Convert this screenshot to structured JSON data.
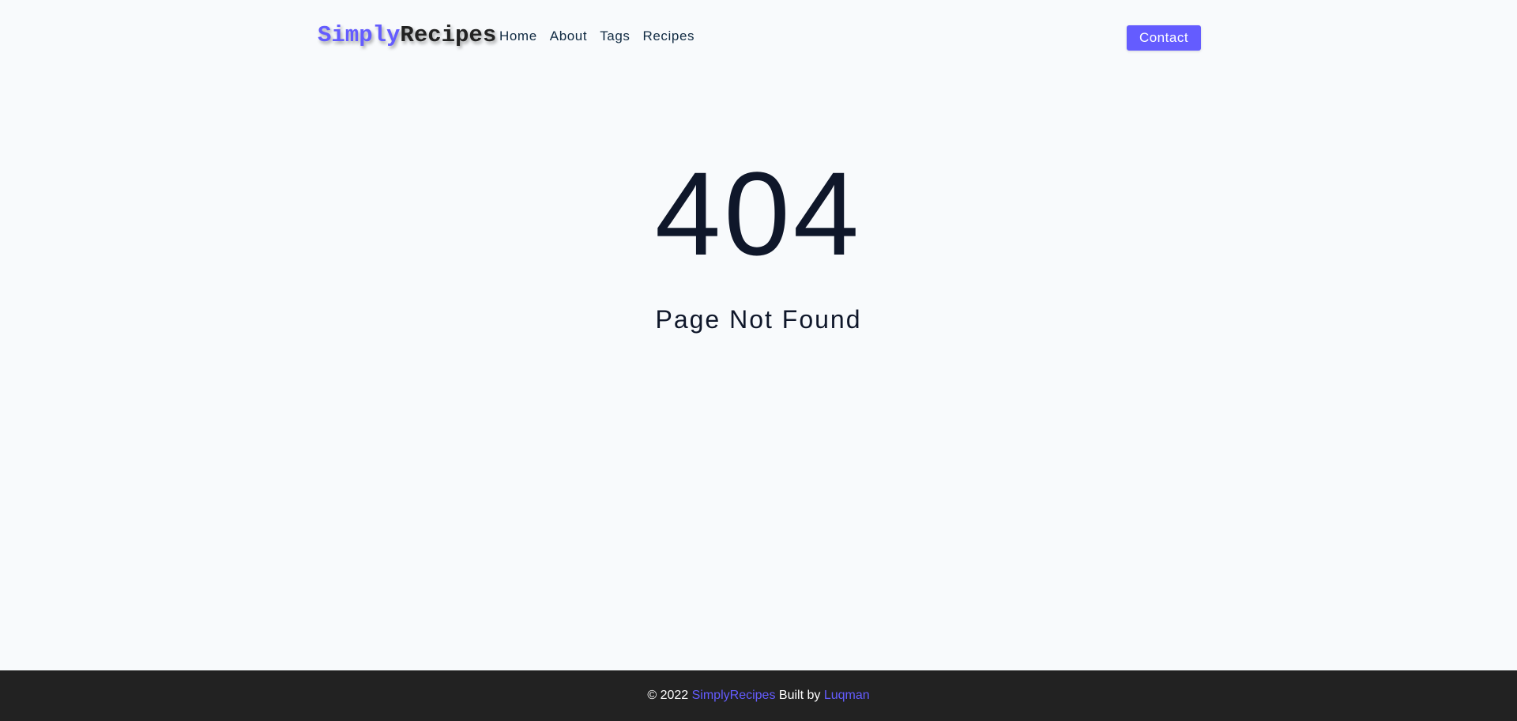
{
  "brand": {
    "part1": "Simply",
    "part2": "Recipes",
    "accent_color": "#645cff"
  },
  "nav": {
    "links": [
      "Home",
      "About",
      "Tags",
      "Recipes"
    ],
    "contact_label": "Contact"
  },
  "error": {
    "code": "404",
    "message": "Page Not Found"
  },
  "footer": {
    "prefix": "© 2022",
    "brand": "SimplyRecipes",
    "built_by": "Built by",
    "author": "Luqman"
  }
}
